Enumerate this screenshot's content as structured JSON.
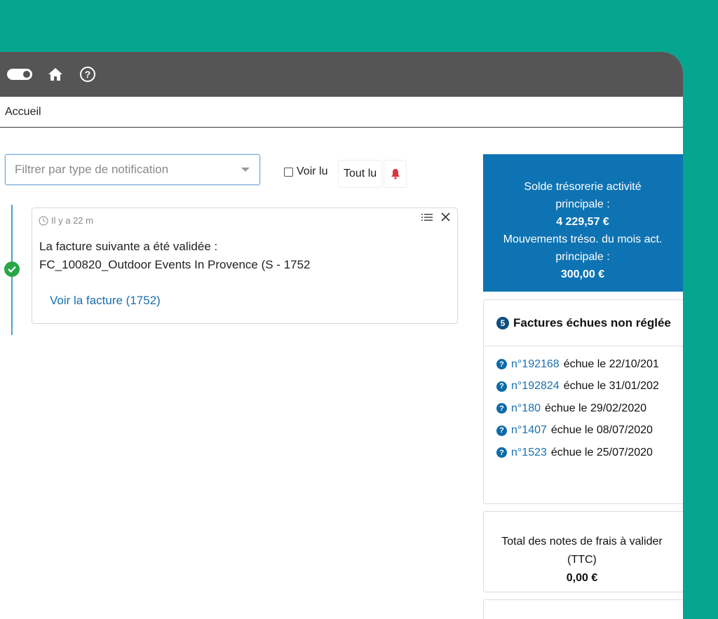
{
  "breadcrumb": {
    "home": "Accueil"
  },
  "filters": {
    "placeholder": "Filtrer par type de notification",
    "voir_lu": "Voir lu",
    "tout_lu": "Tout lu"
  },
  "notification": {
    "time": "Il y a 22 m",
    "line1": "La facture suivante a été validée :",
    "line2": "FC_100820_Outdoor Events In Provence (S - 1752",
    "link": "Voir la facture (1752)"
  },
  "tresorerie": {
    "label1_a": "Solde trésorerie activité",
    "label1_b": "principale :",
    "value1": "4 229,57 €",
    "label2_a": "Mouvements tréso. du mois act.",
    "label2_b": "principale :",
    "value2": "300,00 €"
  },
  "factures": {
    "count": "5",
    "title": "Factures échues non réglée",
    "items": [
      {
        "num": "n°192168",
        "text": "échue le 22/10/201"
      },
      {
        "num": "n°192824",
        "text": "échue le 31/01/202"
      },
      {
        "num": "n°180",
        "text": "échue le 29/02/2020"
      },
      {
        "num": "n°1407",
        "text": "échue le 08/07/2020"
      },
      {
        "num": "n°1523",
        "text": "échue le 25/07/2020"
      }
    ]
  },
  "notes": {
    "label_a": "Total des notes de frais à valider",
    "label_b": "(TTC)",
    "value": "0,00 €"
  },
  "colors": {
    "frame": "#06a58f",
    "topbar": "#555555",
    "primary": "#0e73b3",
    "link": "#1a6fae",
    "success": "#27a745",
    "bell": "#e0323b"
  }
}
